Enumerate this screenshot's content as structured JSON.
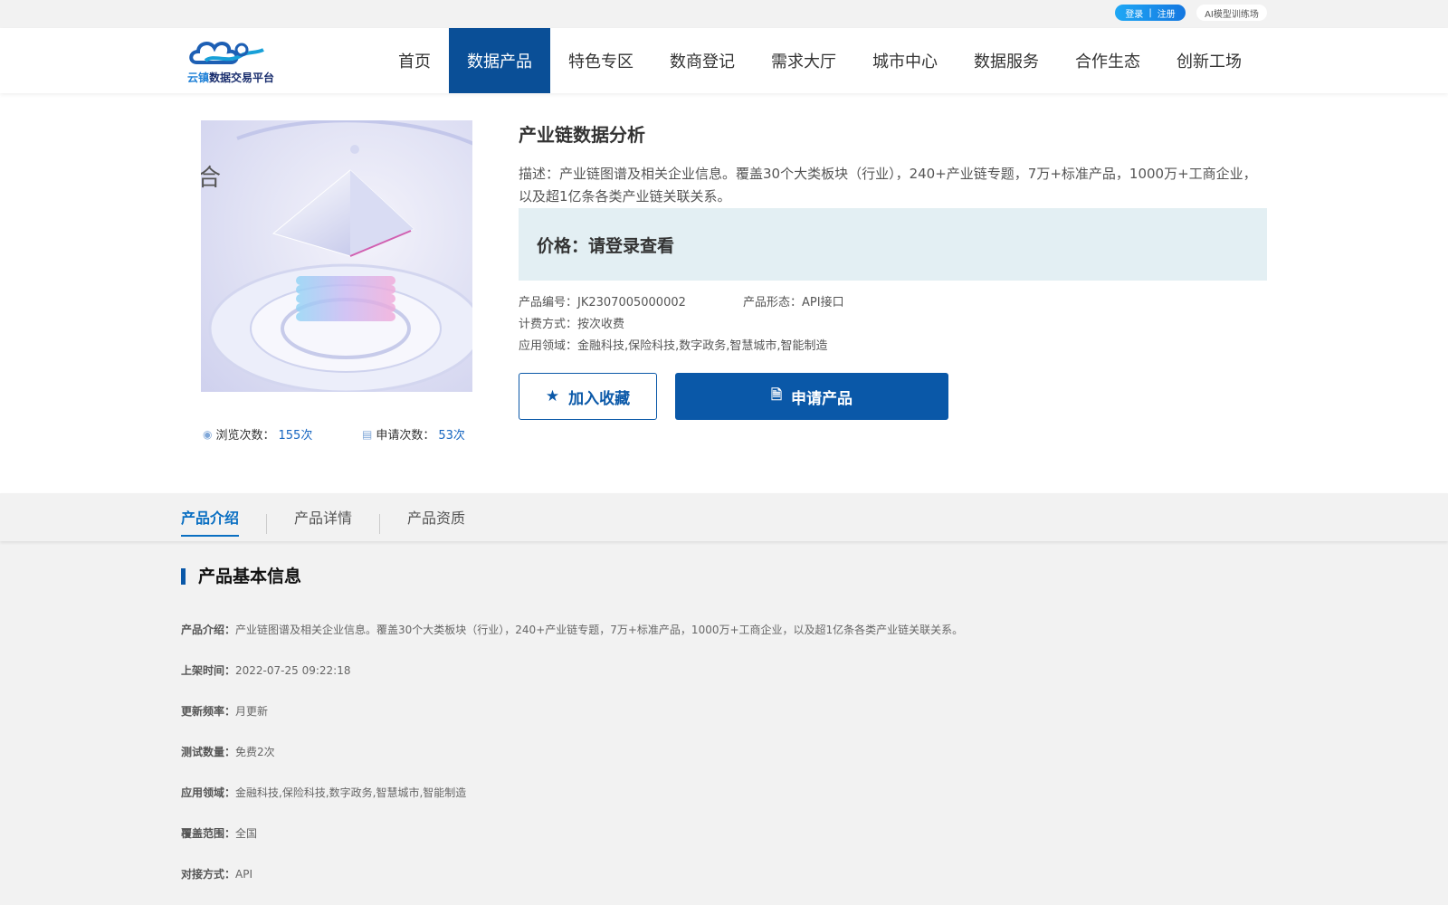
{
  "topbar": {
    "login": "登录",
    "separator": "|",
    "register": "注册",
    "ai_link": "AI模型训练场"
  },
  "logo": {
    "text_a": "云镇",
    "text_b": "数据交易平台"
  },
  "nav": [
    {
      "label": "首页",
      "active": false
    },
    {
      "label": "数据产品",
      "active": true
    },
    {
      "label": "特色专区",
      "active": false
    },
    {
      "label": "数商登记",
      "active": false
    },
    {
      "label": "需求大厅",
      "active": false
    },
    {
      "label": "城市中心",
      "active": false
    },
    {
      "label": "数据服务",
      "active": false
    },
    {
      "label": "合作生态",
      "active": false
    },
    {
      "label": "创新工场",
      "active": false
    }
  ],
  "product": {
    "title": "产业链数据分析",
    "description": "描述：产业链图谱及相关企业信息。覆盖30个大类板块（行业），240+产业链专题，7万+标准产品，1000万+工商企业，以及超1亿条各类产业链关联关系。",
    "price": "价格：请登录查看",
    "code": "产品编号：JK2307005000002",
    "form": "产品形态：API接口",
    "billing": "计费方式：按次收费",
    "domains": "应用领域：金融科技,保险科技,数字政务,智慧城市,智能制造",
    "fav_button": "加入收藏",
    "apply_button": "申请产品",
    "views_label": "浏览次数：",
    "views_value": "155次",
    "applies_label": "申请次数：",
    "applies_value": "53次"
  },
  "tabs": [
    {
      "label": "产品介绍",
      "active": true
    },
    {
      "label": "产品详情",
      "active": false
    },
    {
      "label": "产品资质",
      "active": false
    }
  ],
  "basic_info": {
    "title": "产品基本信息",
    "rows": [
      {
        "label": "产品介绍：",
        "value": "产业链图谱及相关企业信息。覆盖30个大类板块（行业），240+产业链专题，7万+标准产品，1000万+工商企业，以及超1亿条各类产业链关联关系。"
      },
      {
        "label": "上架时间：",
        "value": "2022-07-25 09:22:18"
      },
      {
        "label": "更新频率：",
        "value": "月更新"
      },
      {
        "label": "测试数量：",
        "value": "免费2次"
      },
      {
        "label": "应用领域：",
        "value": "金融科技,保险科技,数字政务,智慧城市,智能制造"
      },
      {
        "label": "覆盖范围：",
        "value": "全国"
      },
      {
        "label": "对接方式：",
        "value": "API"
      }
    ]
  },
  "colors": {
    "brand": "#0a58a8",
    "nav_active": "#0a4f97",
    "price_bg": "#e3eff3",
    "accent_link": "#1565c0"
  }
}
